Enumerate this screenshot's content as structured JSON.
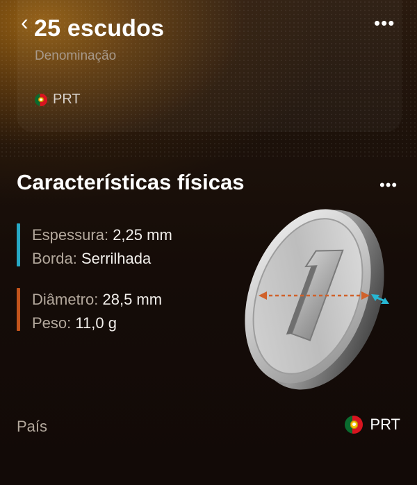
{
  "header": {
    "back_icon": "chevron-left-icon",
    "title": "25 escudos",
    "subtitle": "Denominação",
    "country_code": "PRT",
    "more_icon": "more-horizontal-icon"
  },
  "section": {
    "title": "Características físicas",
    "more_icon": "more-horizontal-icon",
    "specs": [
      {
        "label": "Espessura:",
        "value": "2,25 mm",
        "accent": "#27a8c4"
      },
      {
        "label": "Borda:",
        "value": "Serrilhada",
        "accent": "#27a8c4"
      },
      {
        "label": "Diâmetro:",
        "value": "28,5 mm",
        "accent": "#c2541c"
      },
      {
        "label": "Peso:",
        "value": "11,0 g",
        "accent": "#c2541c"
      }
    ],
    "coin_icon": "coin-illustration-icon"
  },
  "footer": {
    "label": "País",
    "country_code": "PRT",
    "flag_icon": "portugal-flag-icon"
  },
  "colors": {
    "thickness_accent": "#27a8c4",
    "diameter_accent": "#c2541c",
    "brand_gold": "#96601a"
  }
}
